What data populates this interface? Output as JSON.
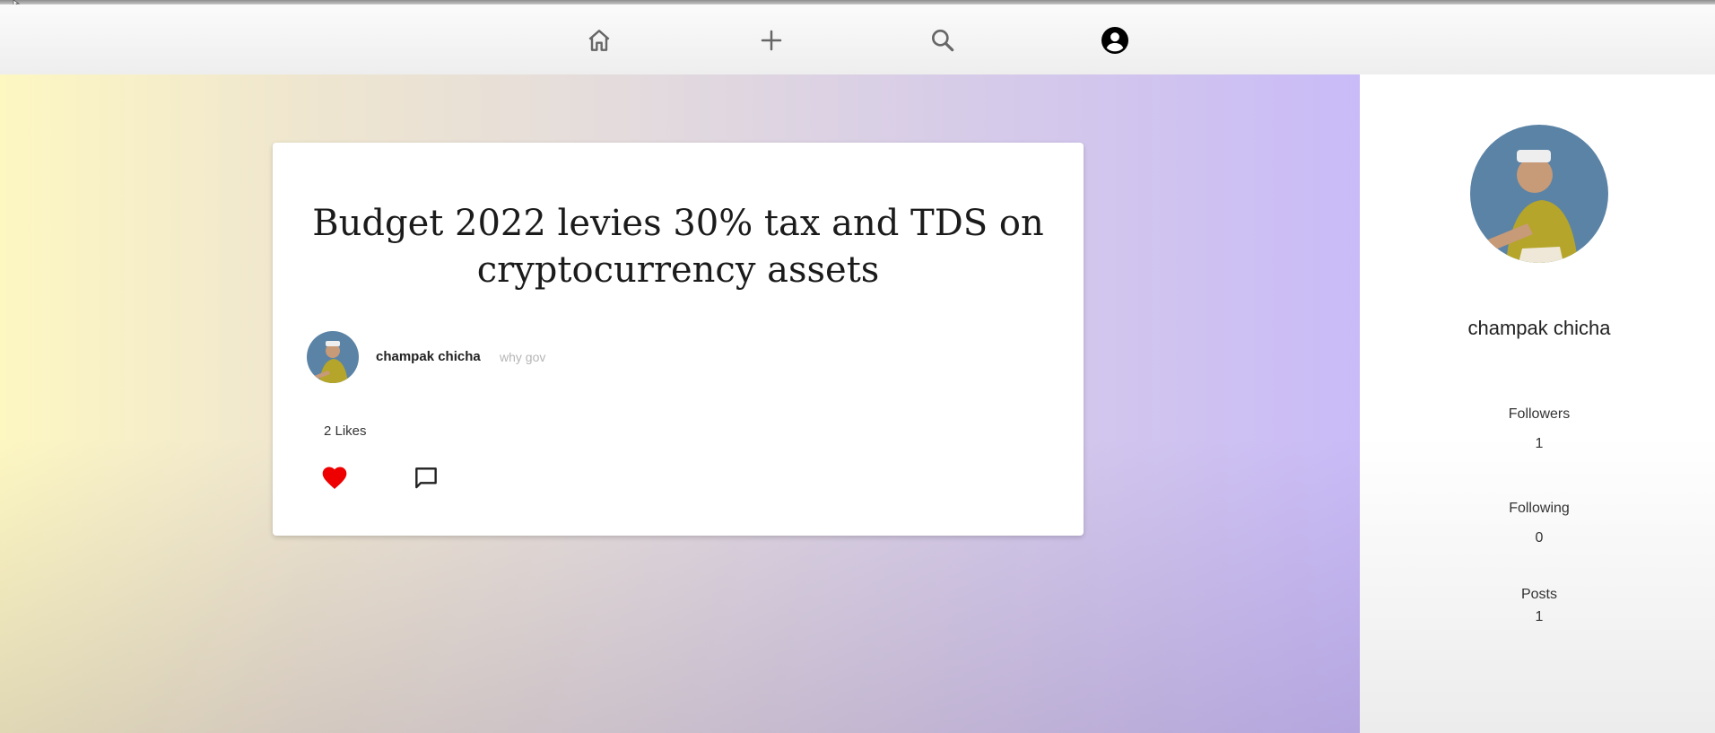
{
  "nav": {
    "items": [
      {
        "icon": "home-icon"
      },
      {
        "icon": "plus-icon"
      },
      {
        "icon": "search-icon"
      },
      {
        "icon": "account-circle-icon"
      }
    ]
  },
  "post": {
    "title": "Budget 2022 levies 30% tax and TDS on cryptocurrency assets",
    "author": "champak chicha",
    "description": "why gov",
    "likes_text": "2 Likes",
    "like_color": "#ee0000",
    "liked": true
  },
  "profile": {
    "name": "champak chicha",
    "followers_label": "Followers",
    "followers": "1",
    "following_label": "Following",
    "following": "0",
    "posts_label": "Posts",
    "posts": "1"
  },
  "colors": {
    "gradient_left": "#fdf7c2",
    "gradient_right": "#c9bbf7"
  }
}
